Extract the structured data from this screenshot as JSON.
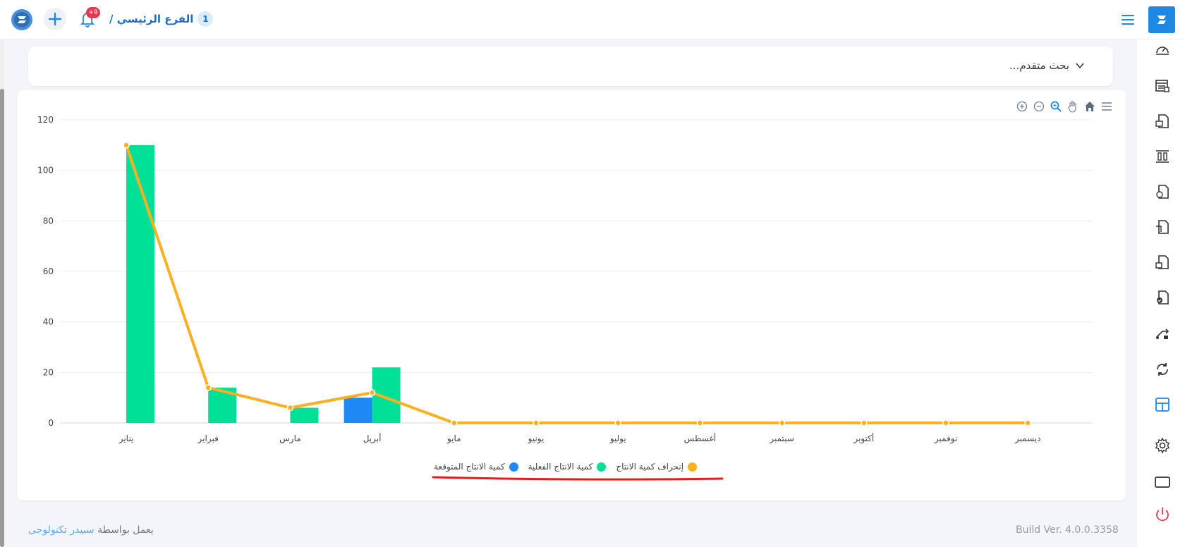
{
  "header": {
    "branch_number": "1",
    "branch_name": "الفرع الرئيسي /",
    "notification_badge": "+9"
  },
  "search": {
    "label": "بحث متقدم..."
  },
  "chart_data": {
    "type": "bar",
    "categories": [
      "يناير",
      "فبراير",
      "مارس",
      "أبريل",
      "مايو",
      "يونيو",
      "يوليو",
      "أغسطس",
      "سبتمبر",
      "أكتوبر",
      "نوفمبر",
      "ديسمبر"
    ],
    "series": [
      {
        "name": "كمية الانتاج المتوقعة",
        "type": "bar",
        "color": "#1e88f5",
        "values": [
          0,
          0,
          0,
          10,
          0,
          0,
          0,
          0,
          0,
          0,
          0,
          0
        ]
      },
      {
        "name": "كمية الانتاج الفعلية",
        "type": "bar",
        "color": "#00e096",
        "values": [
          110,
          14,
          6,
          22,
          0,
          0,
          0,
          0,
          0,
          0,
          0,
          0
        ]
      },
      {
        "name": "إنحراف كمية الانتاج",
        "type": "line",
        "color": "#fdb022",
        "values": [
          110,
          14,
          6,
          12,
          0,
          0,
          0,
          0,
          0,
          0,
          0,
          0
        ]
      }
    ],
    "yticks": [
      "0",
      "20",
      "40",
      "60",
      "80",
      "100",
      "120"
    ],
    "ylim": [
      0,
      120
    ],
    "grid": true,
    "legend_position": "bottom-center"
  },
  "footer": {
    "powered_prefix": "يعمل بواسطة",
    "powered_brand": "سبيدر تكنولوجى",
    "build": "Build Ver. 4.0.0.3358"
  },
  "colors": {
    "accent": "#1e88e5",
    "expected": "#1e88f5",
    "actual": "#00e096",
    "deviation": "#fdb022"
  }
}
